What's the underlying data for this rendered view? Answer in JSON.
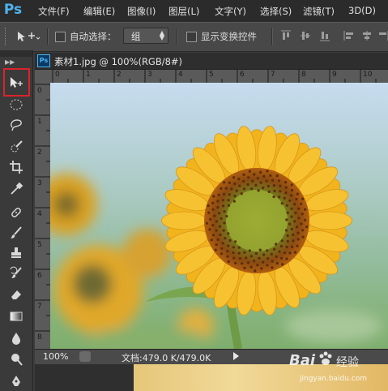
{
  "app": {
    "logo": "Ps"
  },
  "menubar": {
    "items": [
      "文件(F)",
      "编辑(E)",
      "图像(I)",
      "图层(L)",
      "文字(Y)",
      "选择(S)",
      "滤镜(T)",
      "3D(D)"
    ]
  },
  "options_bar": {
    "auto_select_label": "自动选择：",
    "auto_select_value": "组",
    "show_transform_label": "显示变换控件"
  },
  "document": {
    "tab_icon": "Ps",
    "title": "素材1.jpg @ 100%(RGB/8#)"
  },
  "ruler": {
    "horizontal": [
      "0",
      "1",
      "2",
      "3",
      "4",
      "5",
      "6",
      "7",
      "8",
      "9",
      "10"
    ],
    "vertical": [
      "0",
      "1",
      "2",
      "3",
      "4",
      "5",
      "6",
      "7",
      "8"
    ]
  },
  "status": {
    "zoom": "100%",
    "doc_size": "文档:479.0 K/479.0K"
  },
  "watermark": {
    "brand": "Bai",
    "brand2": "经验",
    "url": "jingyan.baidu.com"
  },
  "tools": [
    "move-tool-icon",
    "marquee-tool-icon",
    "lasso-tool-icon",
    "quick-selection-tool-icon",
    "crop-tool-icon",
    "eyedropper-tool-icon",
    "healing-brush-tool-icon",
    "brush-tool-icon",
    "clone-stamp-tool-icon",
    "history-brush-tool-icon",
    "eraser-tool-icon",
    "gradient-tool-icon",
    "blur-tool-icon",
    "dodge-tool-icon",
    "pen-tool-icon"
  ],
  "colors": {
    "highlight": "#d9242a",
    "ps_blue": "#4fb3f0",
    "petal": "#f2b41d"
  }
}
